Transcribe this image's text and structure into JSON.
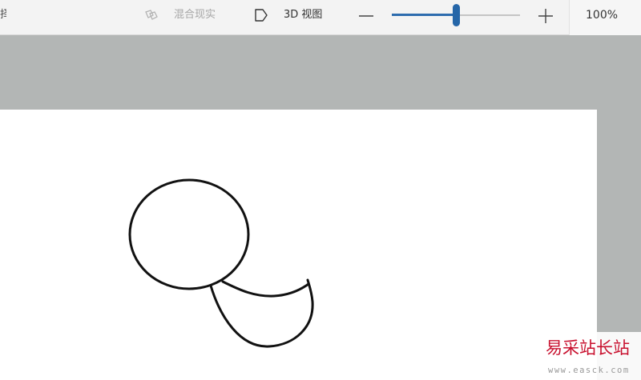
{
  "toolbar": {
    "select_label": "择",
    "mixed_reality_label": "混合现实",
    "view3d_label": "3D 视图",
    "icons": {
      "mixed_reality": "mixed-reality-icon",
      "view3d": "view-3d-icon",
      "zoom_out": "minus-icon",
      "zoom_in": "plus-icon"
    }
  },
  "zoom": {
    "level_fraction": 0.5,
    "value_label": "100%"
  },
  "colors": {
    "accent": "#2566a8",
    "toolbar_bg": "#f3f3f3",
    "workspace_bg": "#b3b6b5",
    "canvas_bg": "#ffffff",
    "disabled_text": "#a6a6a6",
    "watermark_red": "#c8102e"
  },
  "watermark": {
    "title": "易采站长站",
    "url": "www.easck.com"
  }
}
